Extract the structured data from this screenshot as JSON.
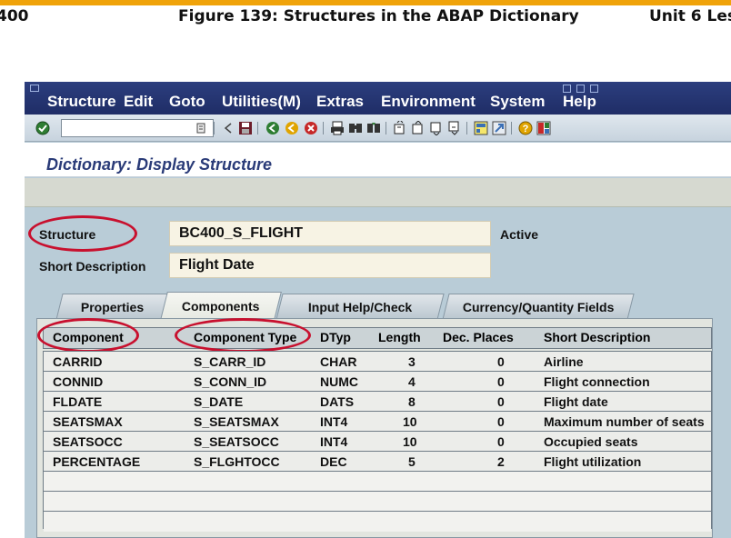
{
  "page_header": {
    "left": "400",
    "figure_title": "Figure 139: Structures in the ABAP Dictionary",
    "right": "Unit 6 Les"
  },
  "menubar": {
    "items": [
      "Structure",
      "Edit",
      "Goto",
      "Utilities(M)",
      "Extras",
      "Environment",
      "System",
      "Help"
    ]
  },
  "toolbar": {
    "command_field_value": ""
  },
  "screen_title": "Dictionary: Display Structure",
  "form": {
    "structure_label": "Structure",
    "structure_value": "BC400_S_FLIGHT",
    "status": "Active",
    "short_desc_label": "Short Description",
    "short_desc_value": "Flight Date"
  },
  "tabs": [
    "Properties",
    "Components",
    "Input Help/Check",
    "Currency/Quantity Fields"
  ],
  "active_tab": "Components",
  "table": {
    "headers": [
      "Component",
      "Component Type",
      "DTyp",
      "Length",
      "Dec. Places",
      "Short Description"
    ],
    "rows": [
      [
        "CARRID",
        "S_CARR_ID",
        "CHAR",
        "3",
        "0",
        "Airline"
      ],
      [
        "CONNID",
        "S_CONN_ID",
        "NUMC",
        "4",
        "0",
        "Flight connection"
      ],
      [
        "FLDATE",
        "S_DATE",
        "DATS",
        "8",
        "0",
        "Flight date"
      ],
      [
        "SEATSMAX",
        "S_SEATSMAX",
        "INT4",
        "10",
        "0",
        "Maximum number of seats"
      ],
      [
        "SEATSOCC",
        "S_SEATSOCC",
        "INT4",
        "10",
        "0",
        "Occupied seats"
      ],
      [
        "PERCENTAGE",
        "S_FLGHTOCC",
        "DEC",
        "5",
        "2",
        "Flight utilization"
      ]
    ]
  },
  "colors": {
    "accent_orange": "#f0a30a",
    "menubar_blue": "#1f2d66",
    "highlight_red": "#c8102e",
    "title_blue": "#2a3b78"
  },
  "icons": [
    "enter-icon",
    "save-icon",
    "back-icon",
    "exit-icon",
    "cancel-icon",
    "print-icon",
    "find-icon",
    "find-next-icon",
    "first-page-icon",
    "prev-page-icon",
    "next-page-icon",
    "last-page-icon",
    "create-session-icon",
    "shortcut-icon",
    "help-icon",
    "layout-icon"
  ]
}
